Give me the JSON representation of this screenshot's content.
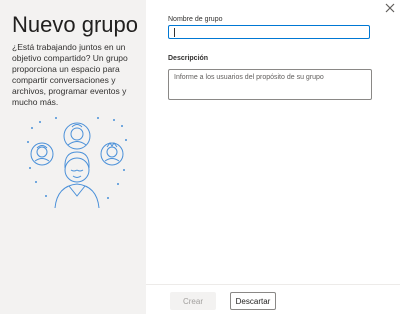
{
  "header": {
    "title": "Nuevo grupo",
    "description": "¿Está trabajando juntos en un objetivo compartido? Un grupo proporciona un espacio para compartir conversaciones y archivos, programar eventos y mucho más."
  },
  "form": {
    "name_label": "Nombre de grupo",
    "name_value": "",
    "description_label": "Descripción",
    "description_placeholder": "Informe a los usuarios del propósito de su grupo"
  },
  "footer": {
    "create_label": "Crear",
    "discard_label": "Descartar"
  },
  "icons": {
    "close": "close-icon",
    "illustration": "group-people-illustration"
  },
  "colors": {
    "accent": "#0078d4",
    "illustration": "#4a90d9",
    "left_pane_bg": "#f3f2f1"
  }
}
